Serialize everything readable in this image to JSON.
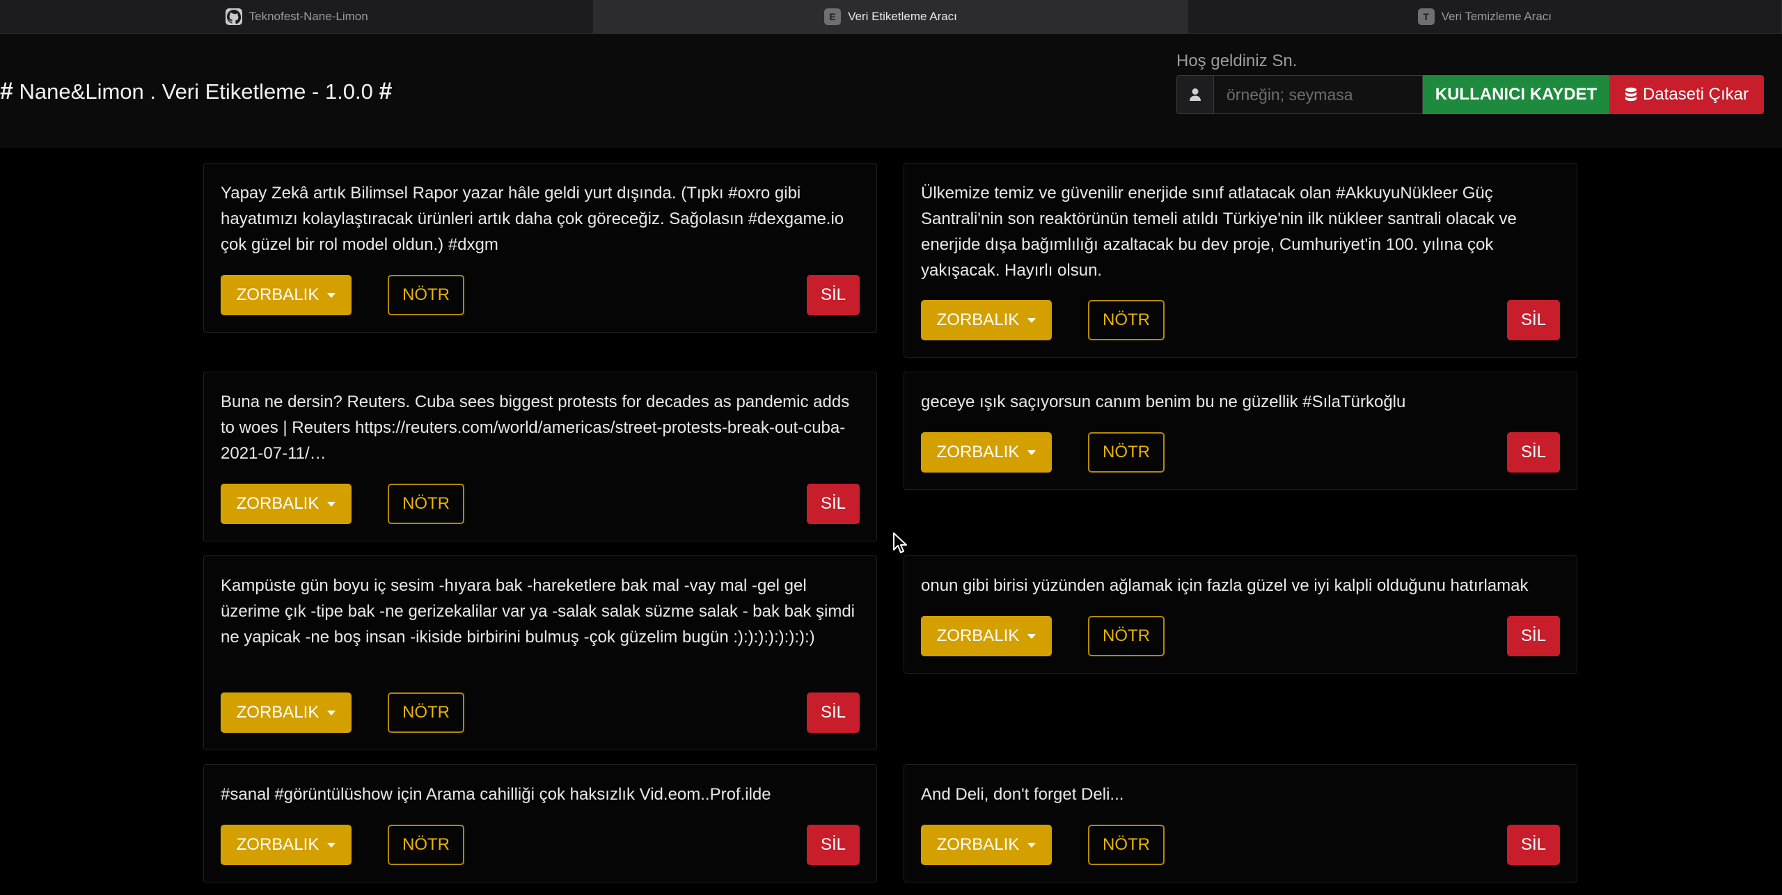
{
  "tabs": [
    {
      "label": "Teknofest-Nane-Limon",
      "favicon": "github-icon"
    },
    {
      "label": "Veri Etiketleme Aracı",
      "favicon_letter": "E"
    },
    {
      "label": "Veri Temizleme Aracı",
      "favicon_letter": "T"
    }
  ],
  "header": {
    "title_hash": "#",
    "title": "Nane&Limon . Veri Etiketleme - 1.0.0",
    "welcome": "Hoş geldiniz Sn.",
    "username_placeholder": "örneğin; seymasa",
    "username_value": "",
    "save_user_label": "KULLANICI KAYDET",
    "export_label": "Dataseti Çıkar"
  },
  "buttons": {
    "bully_label": "ZORBALIK",
    "neutral_label": "NÖTR",
    "delete_label": "SİL"
  },
  "colors": {
    "bully": "#d4a000",
    "neutral_border": "#b48a00",
    "delete": "#c81d2a",
    "save": "#1e8a3d"
  },
  "cards": [
    {
      "text": "Yapay Zekâ artık Bilimsel Rapor yazar hâle geldi yurt dışında. (Tıpkı #oxro gibi hayatımızı kolaylaştıracak ürünleri artık daha çok göreceğiz. Sağolasın #dexgame.io çok güzel bir rol model oldun.) #dxgm"
    },
    {
      "text": "Ülkemize temiz ve güvenilir enerjide sınıf atlatacak olan #AkkuyuNükleer Güç Santrali'nin son reaktörünün temeli atıldı Türkiye'nin ilk nükleer santrali olacak ve enerjide dışa bağımlılığı azaltacak bu dev proje, Cumhuriyet'in 100. yılına çok yakışacak. Hayırlı olsun."
    },
    {
      "text": "Buna ne dersin? Reuters. Cuba sees biggest protests for decades as pandemic adds to woes | Reuters https://reuters.com/world/americas/street-protests-break-out-cuba-2021-07-11/…"
    },
    {
      "text": "geceye ışık saçıyorsun canım benim bu ne güzellik #SılaTürkoğlu"
    },
    {
      "text": "Kampüste gün boyu iç sesim -hıyara bak -hareketlere bak mal -vay mal -gel gel üzerime çık -tipe bak -ne gerizekalilar var ya -salak salak süzme salak - bak bak şimdi ne yapicak -ne boş insan -ikiside birbirini bulmuş -çok güzelim bugün :):):):):):):):)"
    },
    {
      "text": "onun gibi birisi yüzünden ağlamak için fazla güzel ve iyi kalpli olduğunu hatırlamak"
    },
    {
      "text": "#sanal #görüntülüshow için Arama cahilliği çok haksızlık Vid.eom..Prof.ilde"
    },
    {
      "text": "And Deli, don't forget Deli..."
    }
  ]
}
